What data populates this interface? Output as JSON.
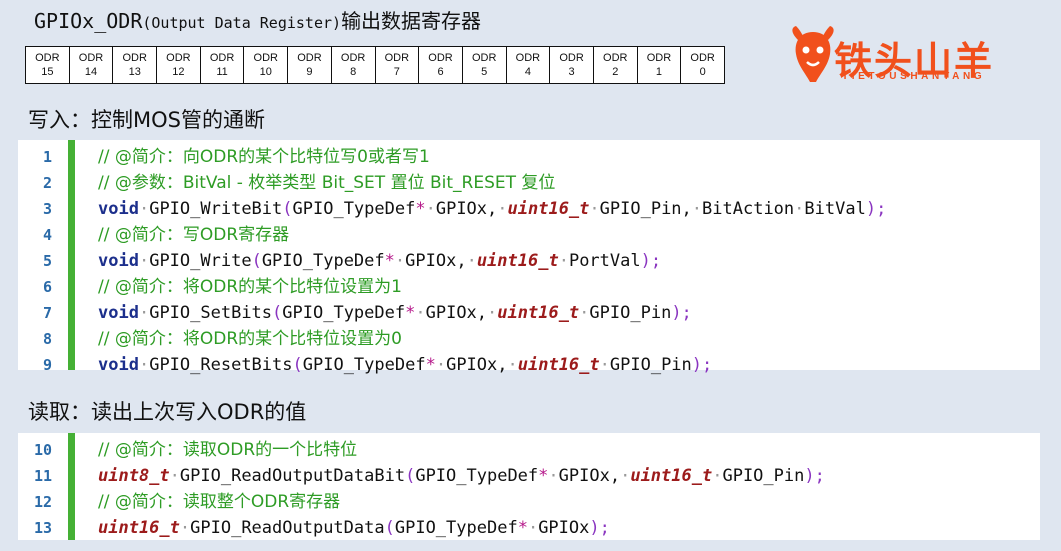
{
  "header": {
    "title_main": "GPIOx_ODR",
    "title_paren": "(Output Data Register)",
    "title_cn": "输出数据寄存器"
  },
  "register": {
    "bits": [
      {
        "name": "ODR",
        "num": "15"
      },
      {
        "name": "ODR",
        "num": "14"
      },
      {
        "name": "ODR",
        "num": "13"
      },
      {
        "name": "ODR",
        "num": "12"
      },
      {
        "name": "ODR",
        "num": "11"
      },
      {
        "name": "ODR",
        "num": "10"
      },
      {
        "name": "ODR",
        "num": "9"
      },
      {
        "name": "ODR",
        "num": "8"
      },
      {
        "name": "ODR",
        "num": "7"
      },
      {
        "name": "ODR",
        "num": "6"
      },
      {
        "name": "ODR",
        "num": "5"
      },
      {
        "name": "ODR",
        "num": "4"
      },
      {
        "name": "ODR",
        "num": "3"
      },
      {
        "name": "ODR",
        "num": "2"
      },
      {
        "name": "ODR",
        "num": "1"
      },
      {
        "name": "ODR",
        "num": "0"
      }
    ]
  },
  "logo": {
    "text": "铁头山羊",
    "sub": "TIETOUSHANYANG",
    "color": "#f1501c"
  },
  "write_section": {
    "label": "写入：控制MOS管的通断",
    "lines": [
      {
        "no": "1",
        "c1": "// @简介：向ODR的某个比特位写0或者写1"
      },
      {
        "no": "2",
        "c1": "// @参数：BitVal - 枚举类型 Bit_SET 置位 Bit_RESET 复位"
      },
      {
        "no": "3",
        "kw": "void",
        "fn": "GPIO_WriteBit",
        "p1": "GPIO_TypeDef",
        "star": "*",
        "a1": "GPIOx,",
        "ty": "uint16_t",
        "a2": "GPIO_Pin,",
        "a3": "BitAction",
        "a4": "BitVal",
        "end": ");"
      },
      {
        "no": "4",
        "c1": "// @简介：写ODR寄存器"
      },
      {
        "no": "5",
        "kw": "void",
        "fn": "GPIO_Write",
        "p1": "GPIO_TypeDef",
        "star": "*",
        "a1": "GPIOx,",
        "ty": "uint16_t",
        "a2": "PortVal",
        "end": ");"
      },
      {
        "no": "6",
        "c1": "// @简介：将ODR的某个比特位设置为1"
      },
      {
        "no": "7",
        "kw": "void",
        "fn": "GPIO_SetBits",
        "p1": "GPIO_TypeDef",
        "star": "*",
        "a1": "GPIOx,",
        "ty": "uint16_t",
        "a2": "GPIO_Pin",
        "end": ");"
      },
      {
        "no": "8",
        "c1": "// @简介：将ODR的某个比特位设置为0"
      },
      {
        "no": "9",
        "kw": "void",
        "fn": "GPIO_ResetBits",
        "p1": "GPIO_TypeDef",
        "star": "*",
        "a1": "GPIOx,",
        "ty": "uint16_t",
        "a2": "GPIO_Pin",
        "end": ");"
      }
    ]
  },
  "read_section": {
    "label": "读取：读出上次写入ODR的值",
    "lines": [
      {
        "no": "10",
        "c1": "// @简介：读取ODR的一个比特位"
      },
      {
        "no": "11",
        "rt": "uint8_t",
        "fn": "GPIO_ReadOutputDataBit",
        "p1": "GPIO_TypeDef",
        "star": "*",
        "a1": "GPIOx,",
        "ty": "uint16_t",
        "a2": "GPIO_Pin",
        "end": ");"
      },
      {
        "no": "12",
        "c1": "// @简介：读取整个ODR寄存器"
      },
      {
        "no": "13",
        "rt": "uint16_t",
        "fn": "GPIO_ReadOutputData",
        "p1": "GPIO_TypeDef",
        "star": "*",
        "a1": "GPIOx",
        "end": ");"
      }
    ]
  }
}
